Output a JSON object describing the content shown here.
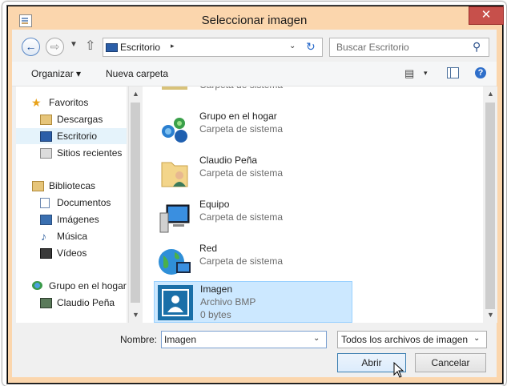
{
  "window": {
    "title": "Seleccionar imagen",
    "close_glyph": "✕"
  },
  "address_bar": {
    "location": "Escritorio",
    "location_icon": "desktop-icon",
    "separator_glyph": "▸",
    "dropdown_glyph": "⌄",
    "refresh_glyph": "↻"
  },
  "search": {
    "placeholder": "Buscar Escritorio",
    "icon": "search-icon"
  },
  "toolbar": {
    "organize_label": "Organizar ▾",
    "new_folder_label": "Nueva carpeta",
    "view_dropdown_glyph": "▾",
    "help_glyph": "?"
  },
  "nav_pane": {
    "favorites": {
      "label": "Favoritos",
      "items": [
        {
          "label": "Descargas",
          "icon": "downloads-icon"
        },
        {
          "label": "Escritorio",
          "icon": "desktop-icon"
        },
        {
          "label": "Sitios recientes",
          "icon": "recent-places-icon"
        }
      ]
    },
    "libraries": {
      "label": "Bibliotecas",
      "items": [
        {
          "label": "Documentos",
          "icon": "documents-icon"
        },
        {
          "label": "Imágenes",
          "icon": "pictures-icon"
        },
        {
          "label": "Música",
          "icon": "music-icon"
        },
        {
          "label": "Vídeos",
          "icon": "videos-icon"
        }
      ]
    },
    "homegroup": {
      "label": "Grupo en el hogar",
      "items": [
        {
          "label": "Claudio Peña",
          "icon": "user-icon"
        }
      ]
    }
  },
  "file_pane": {
    "partial_item_type": "Carpeta de sistema",
    "items": [
      {
        "name": "Grupo en el hogar",
        "type": "Carpeta de sistema",
        "icon": "homegroup-icon"
      },
      {
        "name": "Claudio Peña",
        "type": "Carpeta de sistema",
        "icon": "user-folder-icon"
      },
      {
        "name": "Equipo",
        "type": "Carpeta de sistema",
        "icon": "computer-icon"
      },
      {
        "name": "Red",
        "type": "Carpeta de sistema",
        "icon": "network-icon"
      },
      {
        "name": "Imagen",
        "type": "Archivo BMP",
        "size": "0 bytes",
        "icon": "bmp-image-icon",
        "selected": true
      }
    ]
  },
  "bottom": {
    "name_label": "Nombre:",
    "name_value": "Imagen",
    "file_type": "Todos los archivos de imagen",
    "open_label": "Abrir",
    "cancel_label": "Cancelar"
  },
  "colors": {
    "frame": "#fbd6ad",
    "close": "#c7504b",
    "selection": "#cce8ff",
    "accent": "#2467c9"
  }
}
